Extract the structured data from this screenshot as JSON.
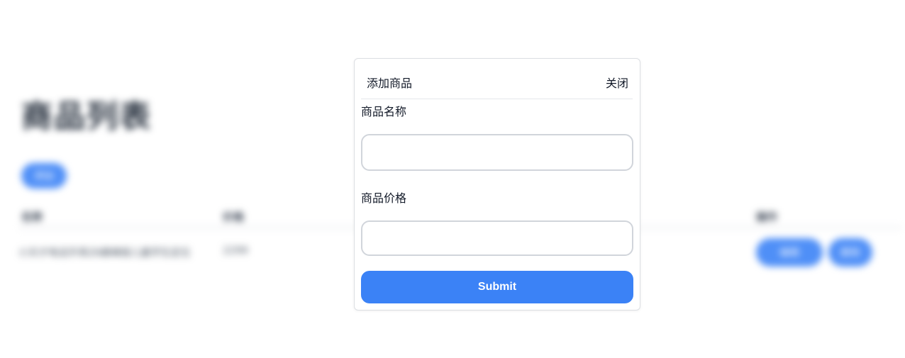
{
  "page": {
    "title": "商品列表",
    "add_label": "添加",
    "table": {
      "headers": [
        "名称",
        "价格",
        "操作"
      ],
      "rows": [
        {
          "name": "小天才电话手表Z6巅峰版儿童学生定位",
          "price": "2299",
          "edit_label": "编辑",
          "delete_label": "删除"
        }
      ]
    }
  },
  "modal": {
    "title": "添加商品",
    "close_label": "关闭",
    "name_label": "商品名称",
    "name_value": "",
    "price_label": "商品价格",
    "price_value": "",
    "submit_label": "Submit"
  },
  "colors": {
    "primary": "#3b82f6",
    "border": "#d1d5db"
  }
}
